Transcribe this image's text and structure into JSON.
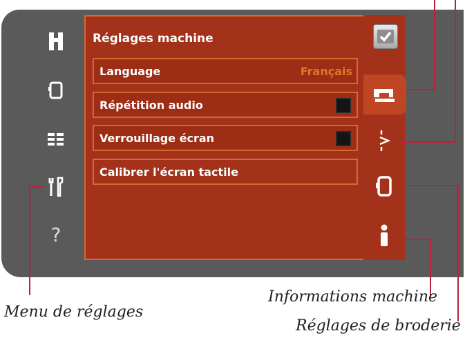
{
  "panel": {
    "title": "Réglages machine",
    "rows": [
      {
        "label": "Language",
        "value": "Français"
      },
      {
        "label": "Répétition audio",
        "checked": false
      },
      {
        "label": "Verrouillage écran",
        "checked": false
      },
      {
        "label": "Calibrer l'écran tactile"
      }
    ]
  },
  "left_icons": [
    "needle-icon",
    "hoop-icon",
    "list-icon",
    "tools-icon",
    "help-icon"
  ],
  "left_help_glyph": "?",
  "tabs": [
    "checkmark-icon",
    "sewing-machine-icon",
    "stitch-icon",
    "hoop-icon",
    "info-icon"
  ],
  "captions": {
    "settings_menu": "Menu de réglages",
    "machine_info": "Informations machine",
    "embroidery_settings": "Réglages de broderie"
  },
  "colors": {
    "panel": "#a4321a",
    "border": "#d6692f",
    "value_text": "#e0762b",
    "frame": "#5a5a5a",
    "callout": "#b8223a"
  }
}
